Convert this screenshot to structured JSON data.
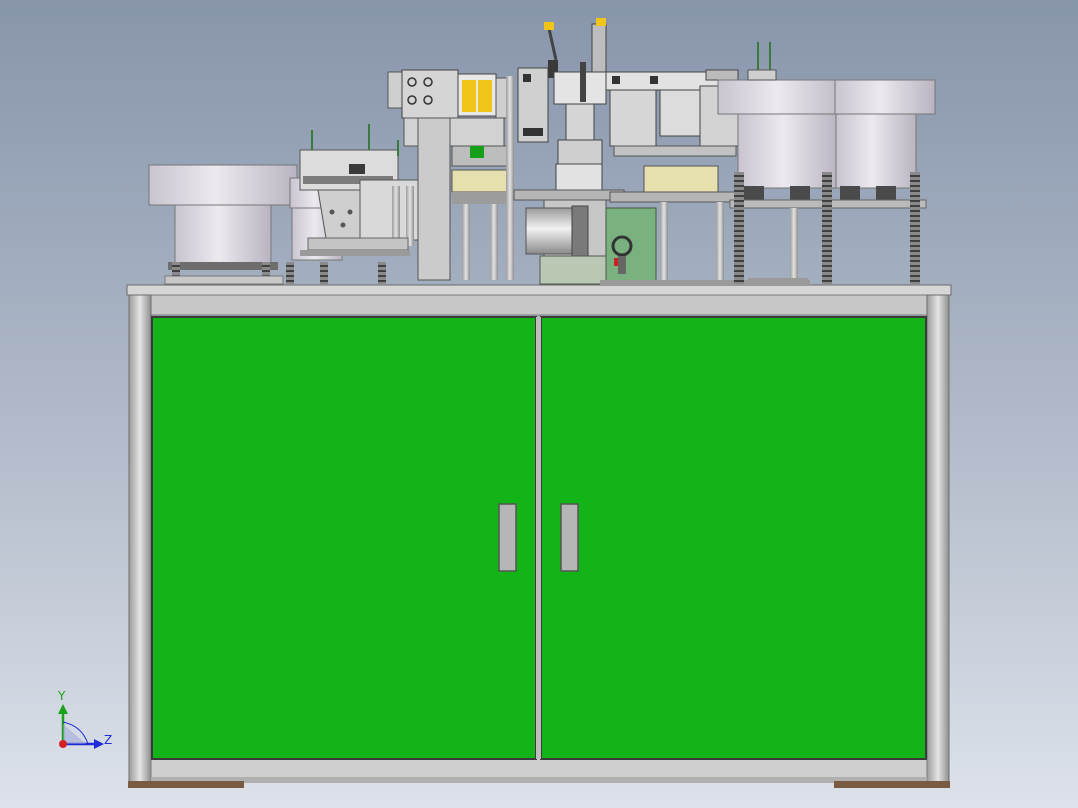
{
  "viewport": {
    "background_top": "#8795ab",
    "background_bottom": "#dde2ea"
  },
  "triad": {
    "y_label": "Y",
    "z_label": "Z",
    "y_color": "#1aa31a",
    "z_color": "#1f2bd6",
    "origin_color": "#d42020"
  },
  "model": {
    "door_color": "#12b417",
    "frame_color": "#c9c9c9",
    "handle_color": "#b4b4b4",
    "feeder_bowl_color": "#d8d4dc",
    "motor_plate_color": "#79b27e",
    "yellow_block_color": "#e6dfae",
    "highlight_yellow": "#f0c419"
  }
}
